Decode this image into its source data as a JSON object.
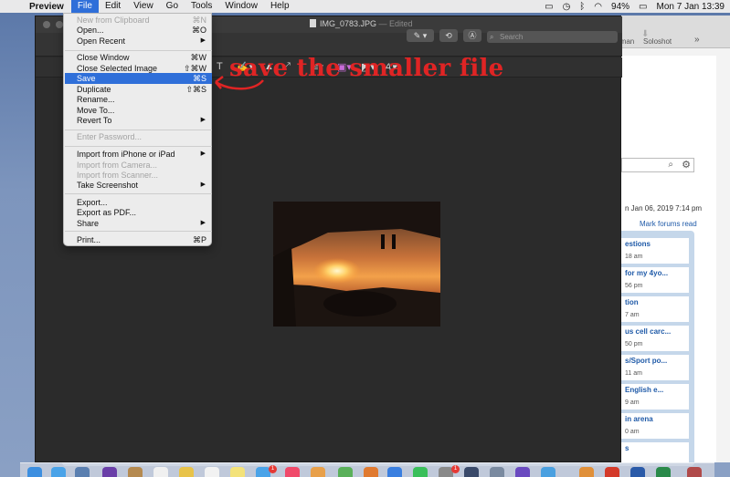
{
  "menubar": {
    "app_name": "Preview",
    "menus": [
      "File",
      "Edit",
      "View",
      "Go",
      "Tools",
      "Window",
      "Help"
    ],
    "active_menu": "File",
    "battery": "94%",
    "clock": "Mon 7 Jan  13:39"
  },
  "preview_window": {
    "filename": "IMG_0783.JPG",
    "edited_suffix": "— Edited",
    "search_placeholder": "Search"
  },
  "file_menu": {
    "items": [
      {
        "label": "New from Clipboard",
        "shortcut": "⌘N",
        "state": "disabled"
      },
      {
        "label": "Open...",
        "shortcut": "⌘O",
        "state": "enabled"
      },
      {
        "label": "Open Recent",
        "shortcut": "",
        "state": "submenu"
      },
      {
        "label": "Close Window",
        "shortcut": "⌘W",
        "state": "enabled"
      },
      {
        "label": "Close Selected Image",
        "shortcut": "⇧⌘W",
        "state": "enabled"
      },
      {
        "label": "Save",
        "shortcut": "⌘S",
        "state": "highlighted"
      },
      {
        "label": "Duplicate",
        "shortcut": "⇧⌘S",
        "state": "enabled"
      },
      {
        "label": "Rename...",
        "shortcut": "",
        "state": "enabled"
      },
      {
        "label": "Move To...",
        "shortcut": "",
        "state": "enabled"
      },
      {
        "label": "Revert To",
        "shortcut": "",
        "state": "submenu"
      },
      {
        "label": "Enter Password...",
        "shortcut": "",
        "state": "disabled"
      },
      {
        "label": "Import from iPhone or iPad",
        "shortcut": "",
        "state": "submenu"
      },
      {
        "label": "Import from Camera...",
        "shortcut": "",
        "state": "disabled"
      },
      {
        "label": "Import from Scanner...",
        "shortcut": "",
        "state": "disabled"
      },
      {
        "label": "Take Screenshot",
        "shortcut": "",
        "state": "submenu"
      },
      {
        "label": "Export...",
        "shortcut": "",
        "state": "enabled"
      },
      {
        "label": "Export as PDF...",
        "shortcut": "",
        "state": "enabled"
      },
      {
        "label": "Share",
        "shortcut": "",
        "state": "submenu"
      },
      {
        "label": "Print...",
        "shortcut": "⌘P",
        "state": "enabled"
      }
    ]
  },
  "annotation": {
    "text": "save the smaller file",
    "color": "#e02424"
  },
  "browser_background": {
    "bookmarks": [
      "Fa",
      "rman",
      "Soloshot"
    ],
    "date_text": "n Jan 06, 2019 7:14 pm",
    "mark_forums_read": "Mark forums read",
    "left_letter": "I",
    "forum_rows": [
      {
        "title": "estions",
        "time": "18 am"
      },
      {
        "title": "for my 4yo...",
        "time": "56 pm"
      },
      {
        "title": "tion",
        "time": "7 am"
      },
      {
        "title": "us cell carc...",
        "time": "50 pm"
      },
      {
        "title": "s/Sport po...",
        "time": "11 am"
      },
      {
        "title": "English e...",
        "time": "9 am"
      },
      {
        "title": "in arena",
        "time": "0 am"
      },
      {
        "title": "s",
        "time": ""
      }
    ]
  },
  "dock": {
    "badges": [
      "1",
      "1"
    ]
  },
  "colors": {
    "menu_highlight": "#2f6fd9",
    "preview_bg": "#2b2b2b",
    "annotation_red": "#e02424"
  }
}
